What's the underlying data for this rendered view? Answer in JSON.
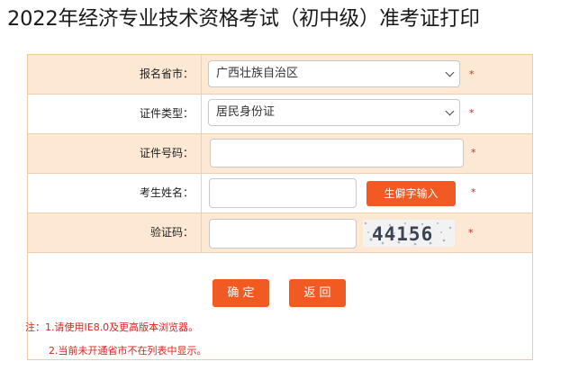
{
  "page": {
    "title": "2022年经济专业技术资格考试（初中级）准考证打印"
  },
  "form": {
    "province": {
      "label": "报名省市：",
      "value": "广西壮族自治区",
      "required_mark": "*"
    },
    "id_type": {
      "label": "证件类型：",
      "value": "居民身份证",
      "required_mark": "*"
    },
    "id_number": {
      "label": "证件号码：",
      "value": "",
      "required_mark": "*"
    },
    "name": {
      "label": "考生姓名：",
      "value": "",
      "rare_char_button": "生僻字输入",
      "required_mark": "*"
    },
    "captcha": {
      "label": "验证码：",
      "value": "",
      "image_text": "44156",
      "required_mark": "*"
    }
  },
  "actions": {
    "confirm_label": "确 定",
    "back_label": "返 回"
  },
  "notes": {
    "line1": "注：1.请使用IE8.0及更高版本浏览器。",
    "line2": "2.当前未开通省市不在列表中显示。"
  },
  "colors": {
    "accent": "#f15a22",
    "row_alt_bg": "#fde8d3",
    "border": "#f0c9a0",
    "required": "#e0201a"
  }
}
